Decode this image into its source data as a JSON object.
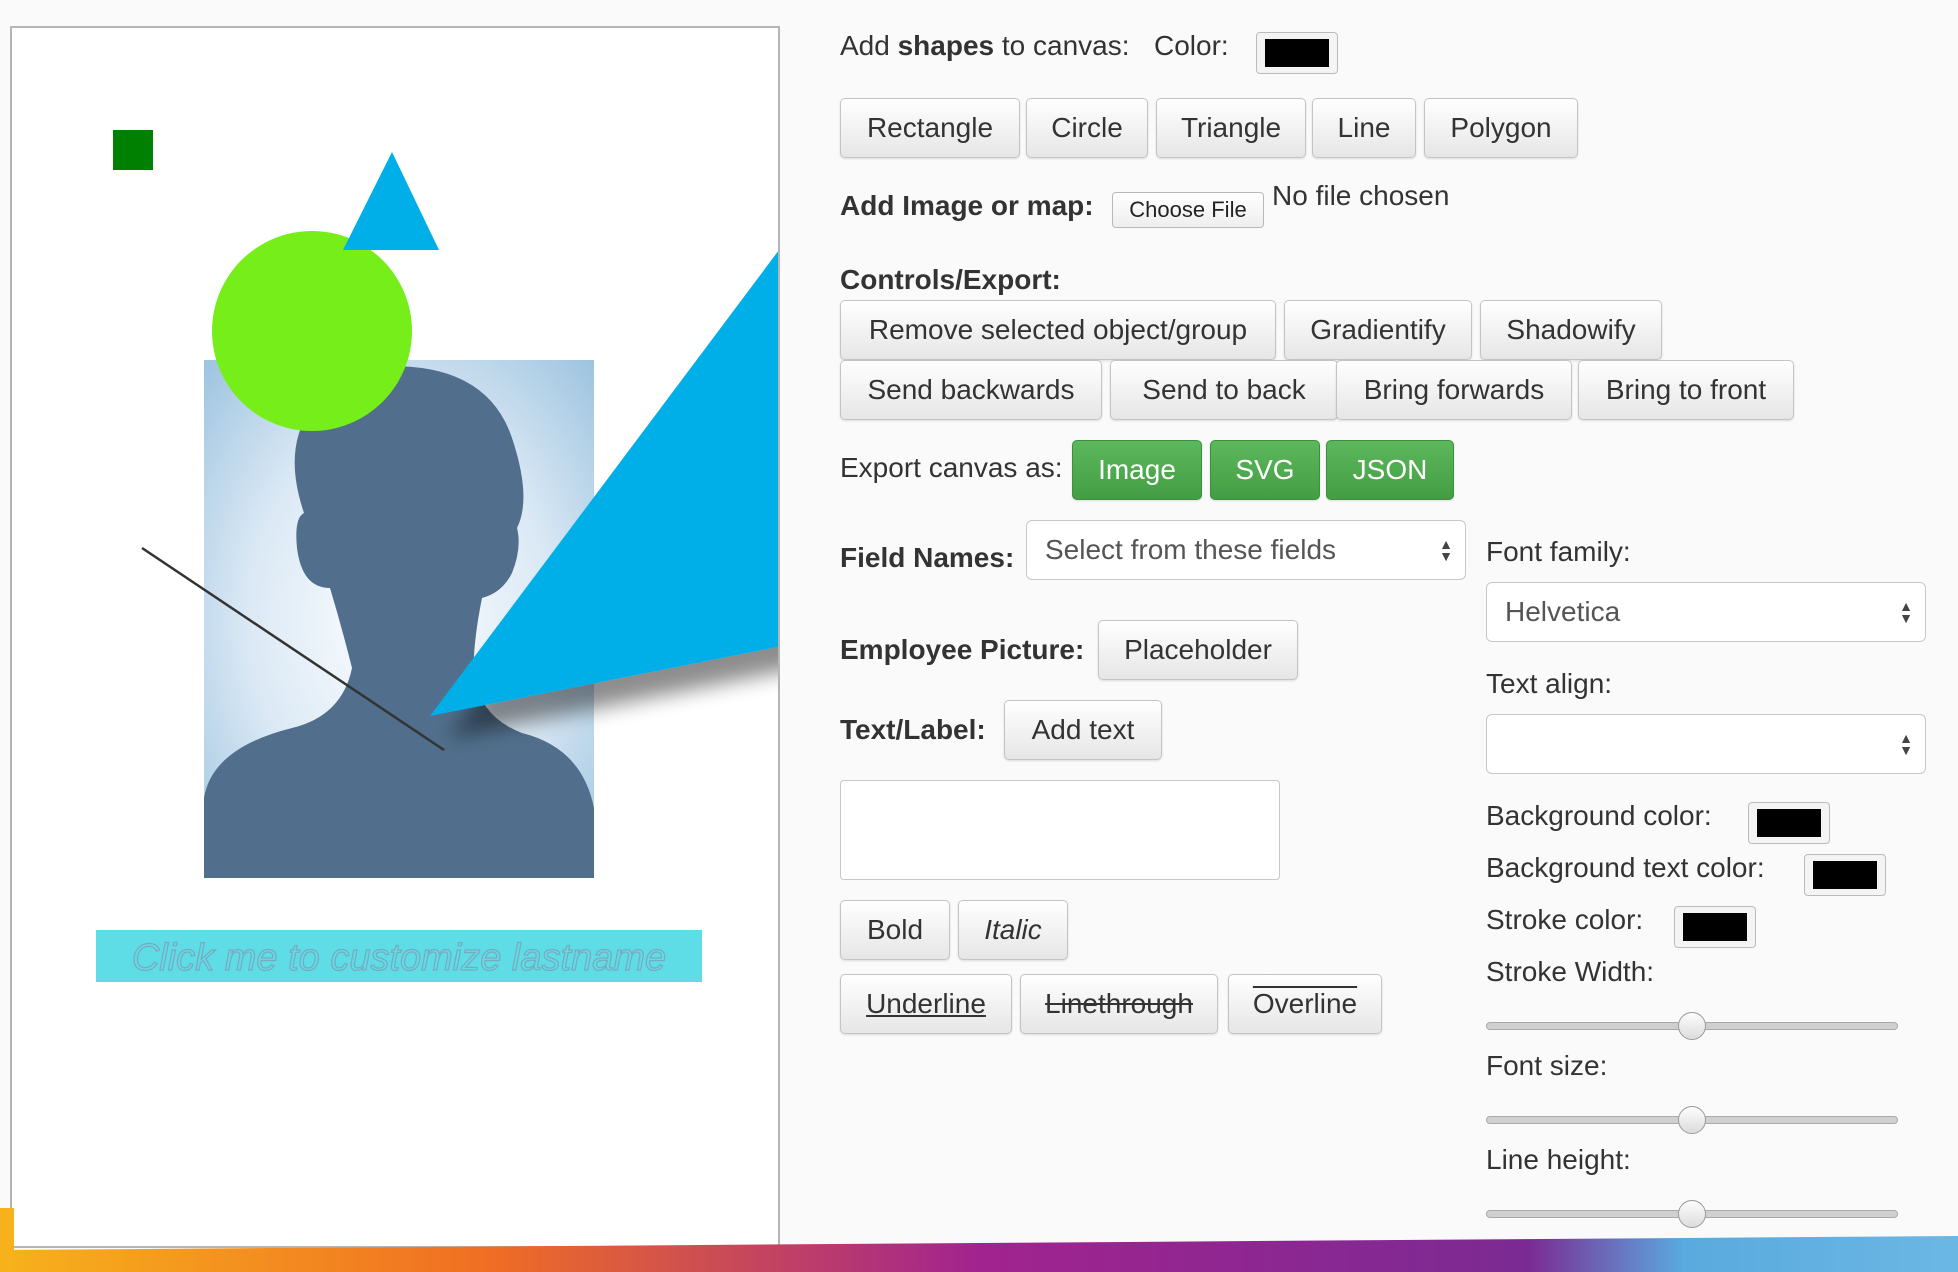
{
  "canvas": {
    "label_text": "Click me to customize lastname",
    "colors": {
      "square": "#008000",
      "triangle": "#00aee8",
      "circle": "#76ee1a",
      "line": "#333333",
      "label_bg": "#5fdde6"
    }
  },
  "shapes": {
    "label_prefix": "Add",
    "label_bold": "shapes",
    "label_suffix": "to canvas:",
    "color_label": "Color:",
    "color_value": "#000000",
    "buttons": [
      "Rectangle",
      "Circle",
      "Triangle",
      "Line",
      "Polygon"
    ]
  },
  "image_upload": {
    "label": "Add Image or map:",
    "button": "Choose File",
    "status": "No file chosen"
  },
  "controls": {
    "heading": "Controls/Export:",
    "row1": [
      "Remove selected object/group",
      "Gradientify",
      "Shadowify"
    ],
    "row2": [
      "Send backwards",
      "Send to back",
      "Bring forwards",
      "Bring to front"
    ]
  },
  "export": {
    "label": "Export canvas as:",
    "buttons": [
      "Image",
      "SVG",
      "JSON"
    ],
    "accent": "#5cb85c"
  },
  "fields": {
    "label": "Field Names:",
    "selected": "Select from these fields"
  },
  "employee": {
    "label": "Employee Picture:",
    "button": "Placeholder"
  },
  "text_label": {
    "label": "Text/Label:",
    "button": "Add text",
    "textarea_value": ""
  },
  "text_style": {
    "bold": "Bold",
    "italic": "Italic",
    "underline": "Underline",
    "linethrough": "Linethrough",
    "overline": "Overline"
  },
  "props": {
    "font_family_label": "Font family:",
    "font_family_value": "Helvetica",
    "text_align_label": "Text align:",
    "text_align_value": "",
    "bg_color_label": "Background color:",
    "bg_text_color_label": "Background text color:",
    "stroke_color_label": "Stroke color:",
    "stroke_width_label": "Stroke Width:",
    "stroke_width_level": 0.5,
    "font_size_label": "Font size:",
    "font_size_level": 0.5,
    "line_height_label": "Line height:",
    "line_height_level": 0.5,
    "swatch_color": "#000000"
  }
}
